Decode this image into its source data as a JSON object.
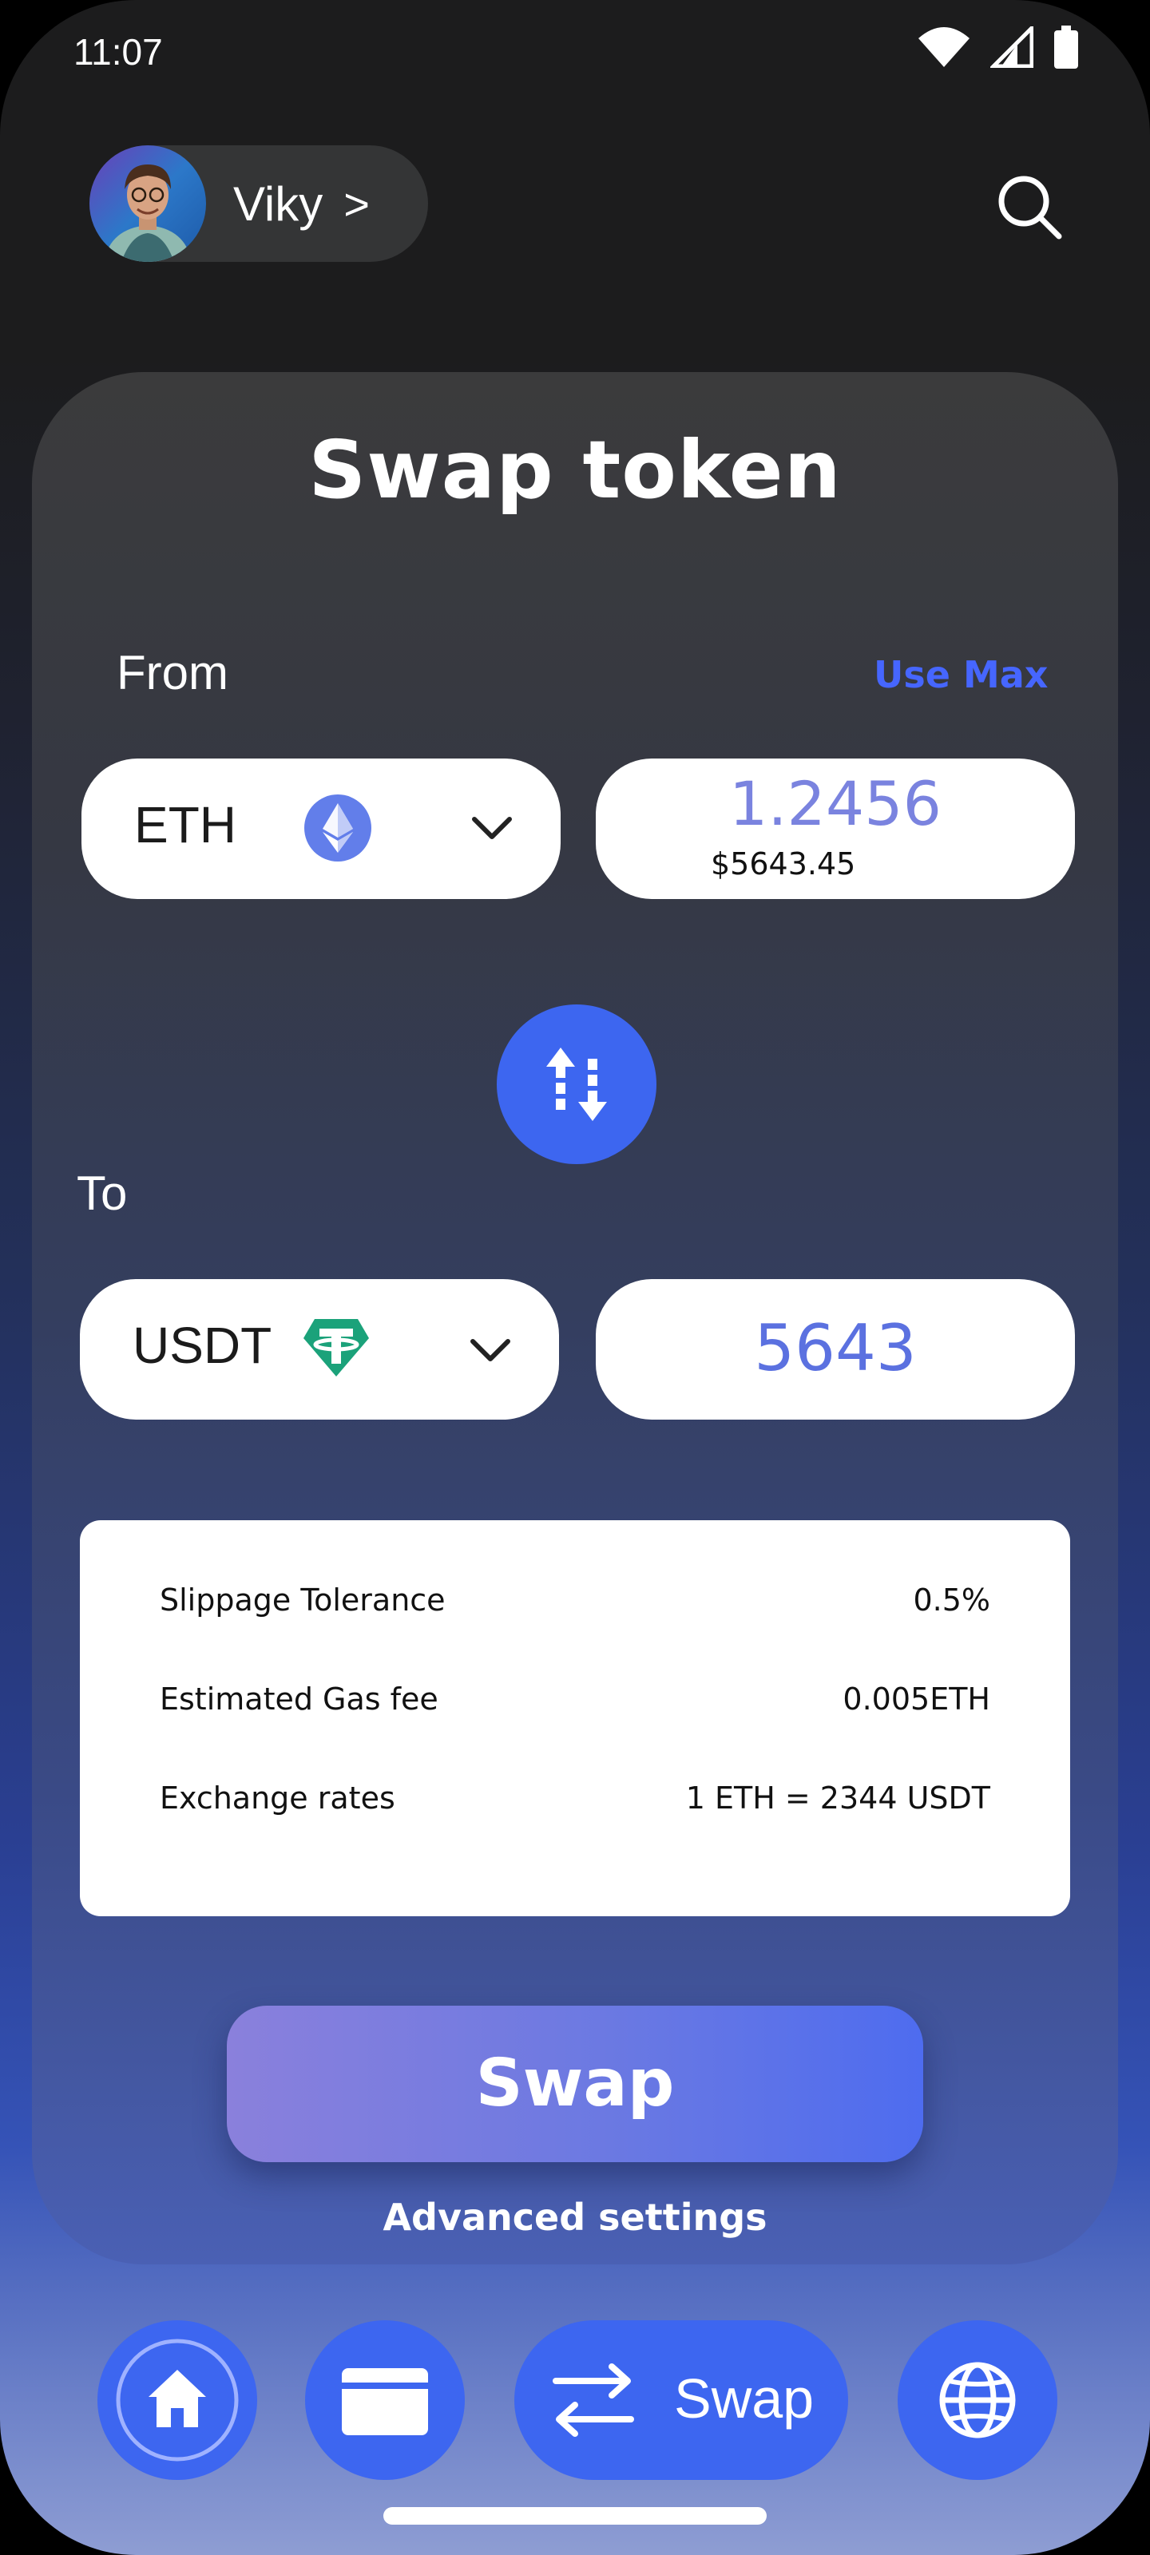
{
  "status_bar": {
    "time": "11:07",
    "icons": [
      "wifi-icon",
      "signal-icon",
      "battery-icon"
    ]
  },
  "header": {
    "user_name": "Viky",
    "chevron": ">",
    "search_icon": "search-icon"
  },
  "swap": {
    "title": "Swap token",
    "from_label": "From",
    "use_max": "Use Max",
    "from_token": "ETH",
    "from_amount": "1.2456",
    "from_fiat": "$5643.45",
    "to_label": "To",
    "to_token": "USDT",
    "to_amount": "5643"
  },
  "details": {
    "rows": [
      {
        "label": "Slippage Tolerance",
        "value": "0.5%"
      },
      {
        "label": "Estimated Gas fee",
        "value": "0.005ETH"
      },
      {
        "label": "Exchange rates",
        "value": "1 ETH = 2344 USDT"
      }
    ]
  },
  "actions": {
    "swap_label": "Swap",
    "advanced_label": "Advanced settings"
  },
  "nav": {
    "items": [
      "home-icon",
      "wallet-icon",
      "swap-icon",
      "globe-icon"
    ],
    "active_label": "Swap"
  },
  "colors": {
    "accent": "#3d66f0",
    "link": "#4666ff",
    "amount": "#7a83df",
    "usdt": "#1ba27a",
    "eth": "#627eea"
  }
}
